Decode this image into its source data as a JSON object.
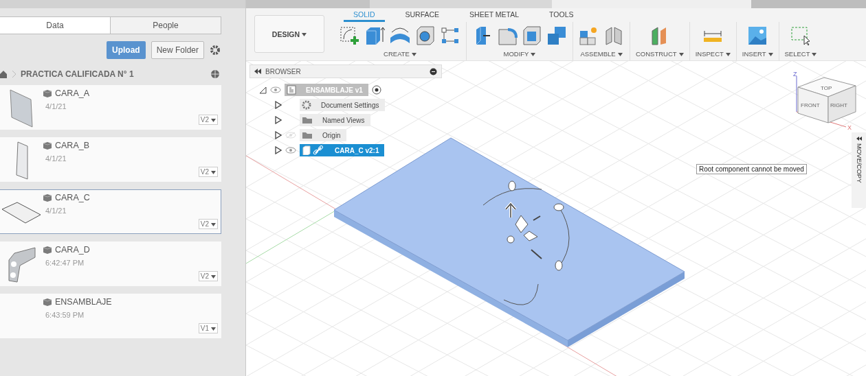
{
  "data_panel": {
    "tabs": [
      {
        "label": "Data",
        "selected": true
      },
      {
        "label": "People",
        "selected": false
      }
    ],
    "upload_button": "Upload",
    "new_folder_button": "New Folder",
    "breadcrumb": "PRACTICA CALIFICADA N° 1",
    "files": [
      {
        "name": "CARA_A",
        "date": "4/1/21",
        "version": "V2",
        "kind": "tall",
        "selected": false
      },
      {
        "name": "CARA_B",
        "date": "4/1/21",
        "version": "V2",
        "kind": "narrow",
        "selected": false
      },
      {
        "name": "CARA_C",
        "date": "4/1/21",
        "version": "V2",
        "kind": "flat",
        "selected": true
      },
      {
        "name": "CARA_D",
        "date": "6:42:47 PM",
        "version": "V2",
        "kind": "bracket",
        "selected": false
      },
      {
        "name": "ENSAMBLAJE",
        "date": "6:43:59 PM",
        "version": "V1",
        "kind": "none",
        "selected": false
      }
    ]
  },
  "toolbar": {
    "workspace": "DESIGN",
    "tabs": [
      {
        "label": "SOLID",
        "selected": true
      },
      {
        "label": "SURFACE",
        "selected": false
      },
      {
        "label": "SHEET METAL",
        "selected": false
      },
      {
        "label": "TOOLS",
        "selected": false
      }
    ],
    "groups": [
      {
        "label": "CREATE",
        "tools": [
          {
            "kind": "sketch"
          },
          {
            "kind": "extrude"
          },
          {
            "kind": "revolve"
          },
          {
            "kind": "hole"
          },
          {
            "kind": "pattern"
          }
        ]
      },
      {
        "label": "MODIFY",
        "tools": [
          {
            "kind": "presspull"
          },
          {
            "kind": "fillet"
          },
          {
            "kind": "shell"
          },
          {
            "kind": "combine"
          }
        ]
      },
      {
        "label": "ASSEMBLE",
        "tools": [
          {
            "kind": "newcomponent"
          },
          {
            "kind": "joint"
          }
        ]
      },
      {
        "label": "CONSTRUCT",
        "tools": [
          {
            "kind": "plane"
          }
        ]
      },
      {
        "label": "INSPECT",
        "tools": [
          {
            "kind": "measure"
          }
        ]
      },
      {
        "label": "INSERT",
        "tools": [
          {
            "kind": "image"
          }
        ]
      },
      {
        "label": "SELECT",
        "tools": [
          {
            "kind": "select"
          }
        ]
      }
    ]
  },
  "browser": {
    "title": "BROWSER",
    "tree": [
      {
        "label": "ENSAMBLAJE v1",
        "kind": "root",
        "expanded": true,
        "visible": true,
        "selected": false,
        "children": [
          {
            "label": "Document Settings",
            "kind": "settings",
            "expanded": false,
            "selected": false
          },
          {
            "label": "Named Views",
            "kind": "folder",
            "expanded": false,
            "selected": false
          },
          {
            "label": "Origin",
            "kind": "folder",
            "expanded": false,
            "visible": false,
            "selected": false
          },
          {
            "label": "CARA_C v2:1",
            "kind": "component",
            "expanded": false,
            "visible": true,
            "selected": true
          }
        ]
      }
    ]
  },
  "view_cube": {
    "top": "TOP",
    "front": "FRONT",
    "right": "RIGHT",
    "z_axis": "Z",
    "x_axis": "X"
  },
  "tooltip": "Root component cannot be moved",
  "side_panel": "MOVE/COPY"
}
